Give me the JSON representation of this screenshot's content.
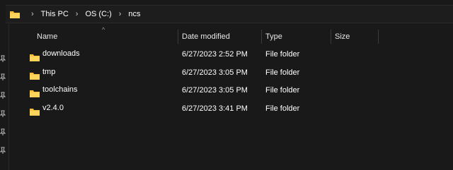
{
  "address_bar": {
    "breadcrumbs": [
      "This PC",
      "OS (C:)",
      "ncs"
    ]
  },
  "columns": {
    "name": "Name",
    "date_modified": "Date modified",
    "type": "Type",
    "size": "Size"
  },
  "files": [
    {
      "name": "downloads",
      "date_modified": "6/27/2023 2:52 PM",
      "type": "File folder",
      "size": ""
    },
    {
      "name": "tmp",
      "date_modified": "6/27/2023 3:05 PM",
      "type": "File folder",
      "size": ""
    },
    {
      "name": "toolchains",
      "date_modified": "6/27/2023 3:05 PM",
      "type": "File folder",
      "size": ""
    },
    {
      "name": "v2.4.0",
      "date_modified": "6/27/2023 3:41 PM",
      "type": "File folder",
      "size": ""
    }
  ],
  "colors": {
    "background": "#191919",
    "folder_yellow": "#f5c243",
    "text": "#ffffff"
  }
}
